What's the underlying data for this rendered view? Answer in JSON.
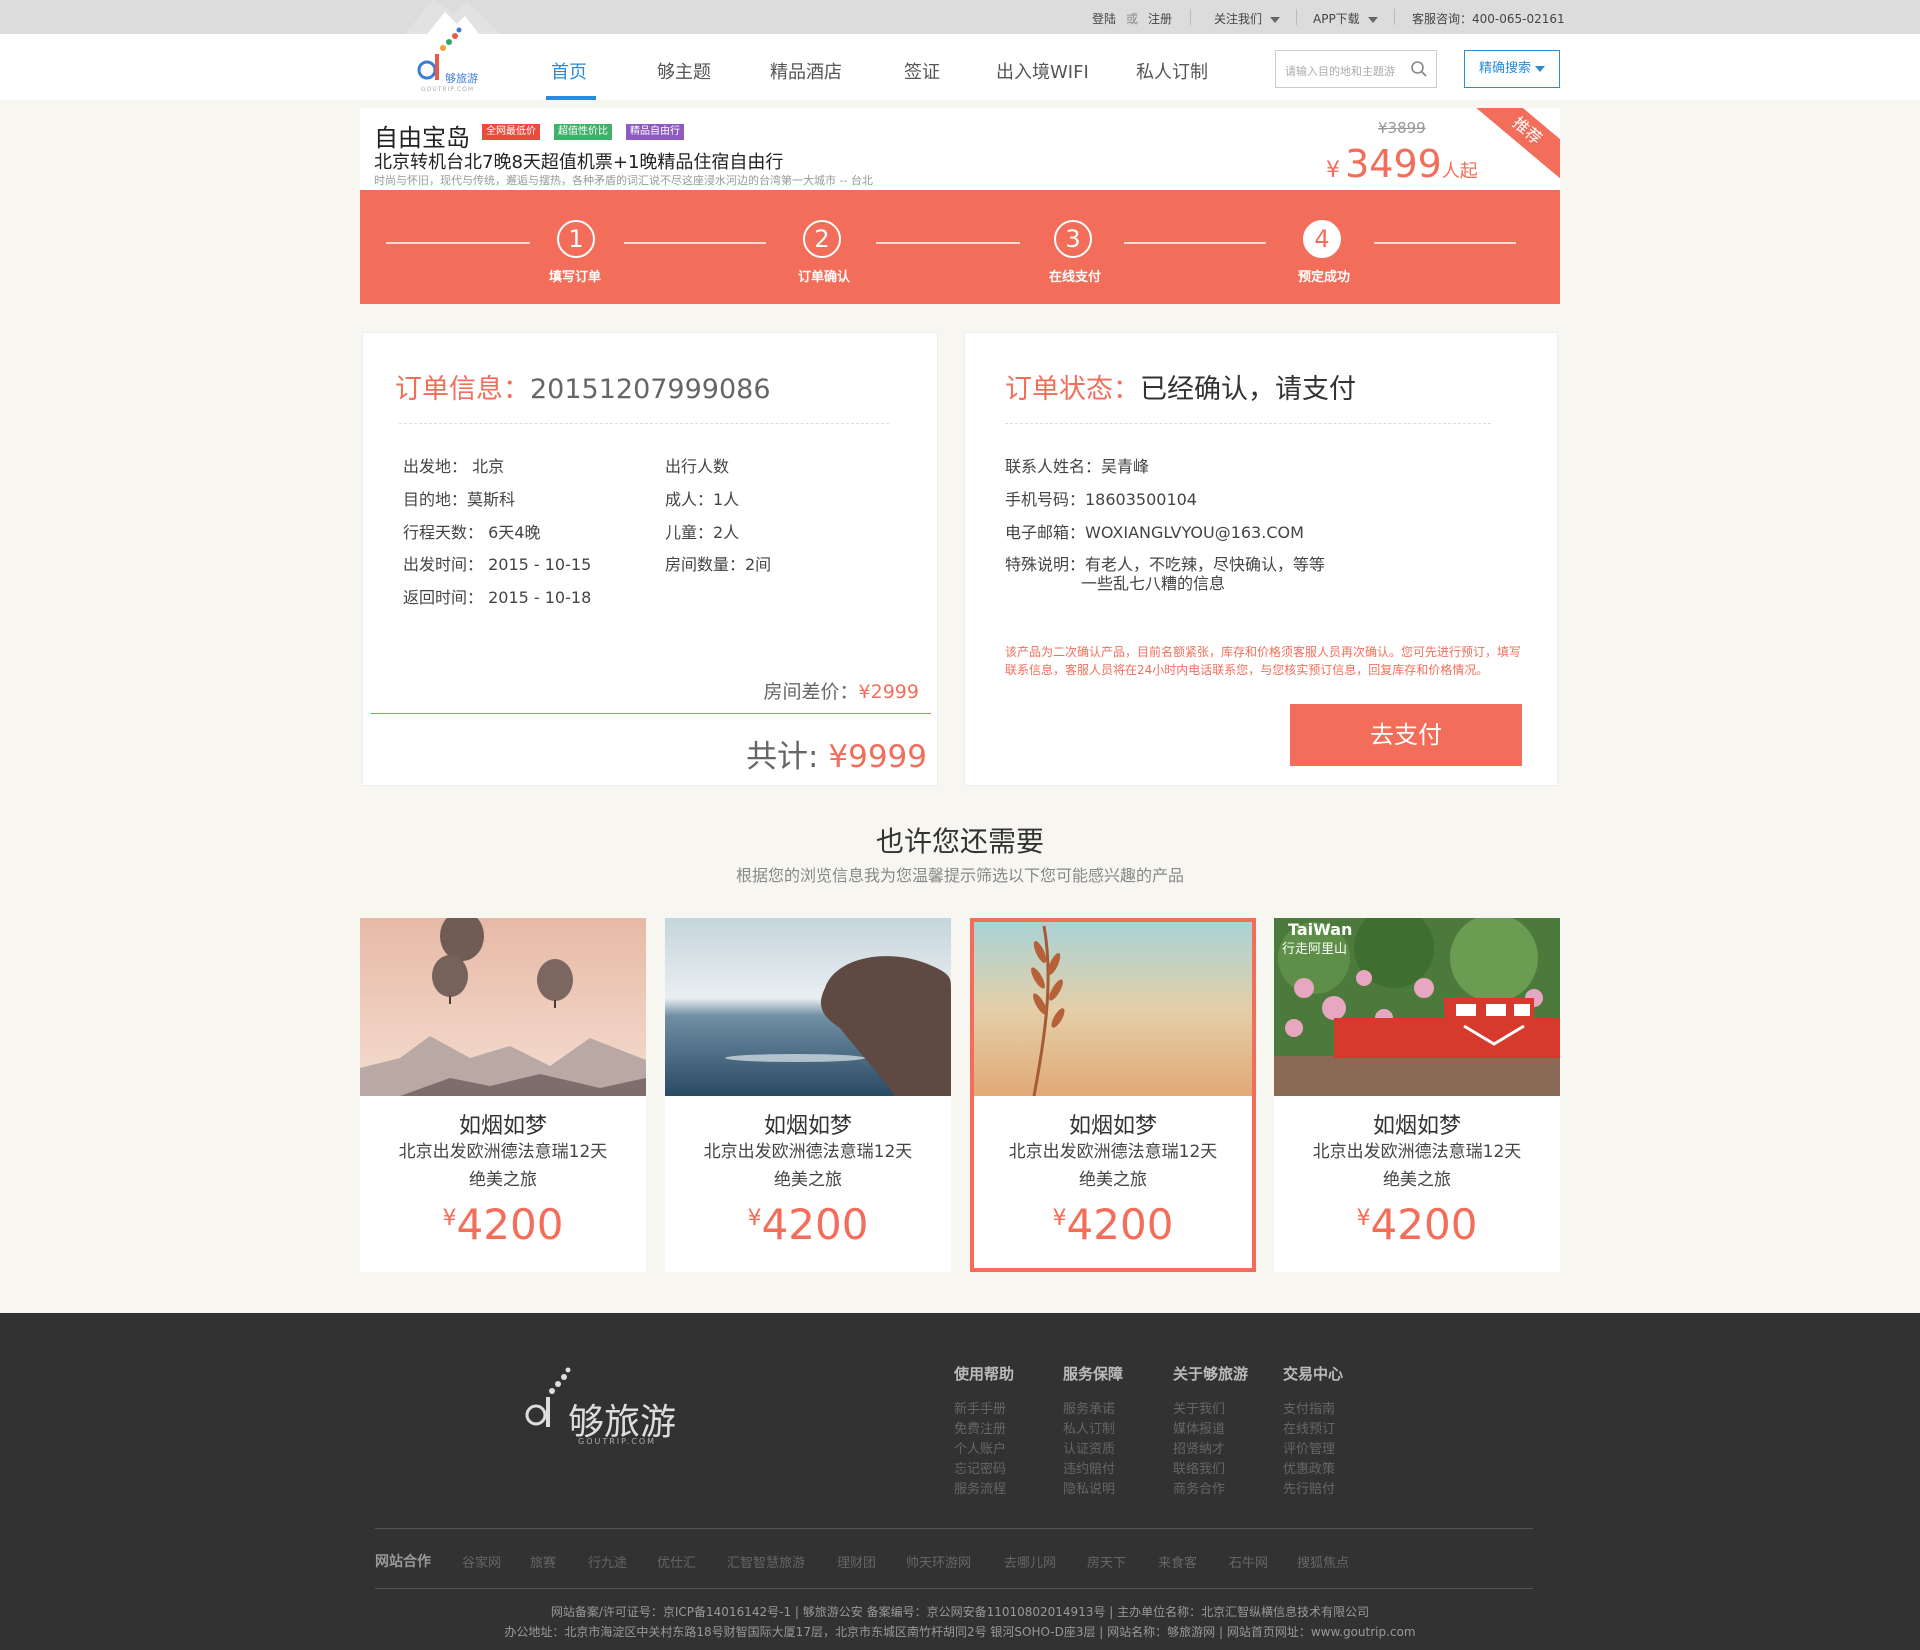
{
  "topbar": {
    "login": "登陆",
    "or": "或",
    "register": "注册",
    "follow": "关注我们",
    "app": "APP下载",
    "service": "客服咨询：400-065-02161"
  },
  "brand": {
    "small_text": "够旅游",
    "small_domain": "GOUTRIP.COM"
  },
  "nav": {
    "items": [
      "首页",
      "够主题",
      "精品酒店",
      "签证",
      "出入境WIFI",
      "私人订制"
    ],
    "search_placeholder": "请输入目的地和主题游",
    "precise_search": "精确搜索"
  },
  "product": {
    "title": "自由宝岛",
    "tags": [
      "全网最低价",
      "超值性价比",
      "精品自由行"
    ],
    "subtitle": "北京转机台北7晚8天超值机票+1晚精品住宿自由行",
    "description": "时尚与怀旧，现代与传统，邂逅与摆热，各种矛盾的词汇说不尽这座浸水河边的台湾第一大城市 -- 台北",
    "old_price": "¥3899",
    "price_symbol": "¥",
    "price": "3499",
    "price_unit": "人起",
    "ribbon": "推荐"
  },
  "steps": [
    {
      "num": "1",
      "label": "填写订单"
    },
    {
      "num": "2",
      "label": "订单确认"
    },
    {
      "num": "3",
      "label": "在线支付"
    },
    {
      "num": "4",
      "label": "预定成功"
    }
  ],
  "order_info": {
    "title_label": "订单信息：",
    "order_no": "20151207999086",
    "left": [
      "出发地：  北京",
      "目的地：莫斯科",
      "行程天数：  6天4晚",
      "出发时间：  2015 - 10-15",
      "返回时间：  2015 - 10-18"
    ],
    "right": [
      "出行人数",
      "成人：1人",
      "儿童：2人",
      "房间数量：2间"
    ],
    "room_diff_label": "房间差价：",
    "room_diff_value": "¥2999",
    "total_label": "共计:",
    "total_value": "¥9999"
  },
  "order_status": {
    "title_label": "订单状态：",
    "status": "已经确认，请支付",
    "contact": "联系人姓名：吴青峰",
    "phone": "手机号码：18603500104",
    "email": "电子邮箱：WOXIANGLVYOU@163.COM",
    "special_1": "特殊说明：有老人，不吃辣，尽快确认，等等",
    "special_2": "一些乱七八糟的信息",
    "note": "该产品为二次确认产品，目前名额紧张，库存和价格须客服人员再次确认。您可先进行预订，填写联系信息，客服人员将在24小时内电话联系您，与您核实预订信息，回复库存和价格情况。",
    "pay_button": "去支付"
  },
  "recommend": {
    "title": "也许您还需要",
    "subtitle": "根据您的浏览信息我为您温馨提示筛选以下您可能感兴趣的产品",
    "cards": [
      {
        "name": "如烟如梦",
        "desc_1": "北京出发欧洲德法意瑞12天",
        "desc_2": "绝美之旅",
        "symbol": "¥",
        "price": "4200"
      },
      {
        "name": "如烟如梦",
        "desc_1": "北京出发欧洲德法意瑞12天",
        "desc_2": "绝美之旅",
        "symbol": "¥",
        "price": "4200"
      },
      {
        "name": "如烟如梦",
        "desc_1": "北京出发欧洲德法意瑞12天",
        "desc_2": "绝美之旅",
        "symbol": "¥",
        "price": "4200"
      },
      {
        "name": "如烟如梦",
        "desc_1": "北京出发欧洲德法意瑞12天",
        "desc_2": "绝美之旅",
        "symbol": "¥",
        "price": "4200",
        "image_text_1": "TaiWan",
        "image_text_2": "行走阿里山"
      }
    ]
  },
  "footer": {
    "logo_text": "够旅游",
    "logo_domain": "GOUTRIP.COM",
    "columns": [
      {
        "title": "使用帮助",
        "items": [
          "新手手册",
          "免费注册",
          "个人账户",
          "忘记密码",
          "服务流程"
        ]
      },
      {
        "title": "服务保障",
        "items": [
          "服务承诺",
          "私人订制",
          "认证资质",
          "违约赔付",
          "隐私说明"
        ]
      },
      {
        "title": "关于够旅游",
        "items": [
          "关于我们",
          "媒体报道",
          "招贤纳才",
          "联络我们",
          "商务合作"
        ]
      },
      {
        "title": "交易中心",
        "items": [
          "支付指南",
          "在线预订",
          "评价管理",
          "优惠政策",
          "先行赔付"
        ]
      }
    ],
    "partners_label": "网站合作",
    "partners": [
      "谷家网",
      "旅赛",
      "行九途",
      "优仕汇",
      "汇智智慧旅游",
      "理财团",
      "帅天环游网",
      "去哪儿网",
      "房天下",
      "来食客",
      "石牛网",
      "搜狐焦点"
    ],
    "legal_1": "网站备案/许可证号：京ICP备14016142号-1 | 够旅游公安 备案编号：京公网安备11010802014913号 | 主办单位名称：北京汇智纵横信息技术有限公司",
    "legal_2": "办公地址：北京市海淀区中关村东路18号财智国际大厦17层，北京市东城区南竹杆胡同2号 银河SOHO-D座3层 | 网站名称：够旅游网 | 网站首页网址：www.goutrip.com"
  },
  "colors": {
    "accent": "#f36e5a",
    "nav_active": "#2a8bd7",
    "footer_bg": "#323232"
  }
}
